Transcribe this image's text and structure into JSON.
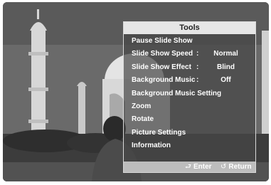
{
  "panel": {
    "title": "Tools",
    "items": [
      {
        "label": "Pause Slide Show",
        "colon": "",
        "value": ""
      },
      {
        "label": "Slide Show Speed",
        "colon": ":",
        "value": "Normal"
      },
      {
        "label": "Slide Show Effect",
        "colon": ":",
        "value": "Blind"
      },
      {
        "label": "Background Music",
        "colon": ":",
        "value": "Off"
      },
      {
        "label": "Background Music Setting",
        "colon": "",
        "value": ""
      },
      {
        "label": "Zoom",
        "colon": "",
        "value": ""
      },
      {
        "label": "Rotate",
        "colon": "",
        "value": ""
      },
      {
        "label": "Picture Settings",
        "colon": "",
        "value": ""
      },
      {
        "label": "Information",
        "colon": "",
        "value": ""
      }
    ],
    "footer": {
      "enter_label": "Enter",
      "return_label": "Return",
      "enter_icon": "enter-icon",
      "return_icon": "return-icon"
    }
  },
  "colors": {
    "panel_title_bg": "#e6e6e6",
    "panel_bg": "#464646",
    "footer_bg": "#bdbdbd",
    "text": "#ffffff"
  }
}
